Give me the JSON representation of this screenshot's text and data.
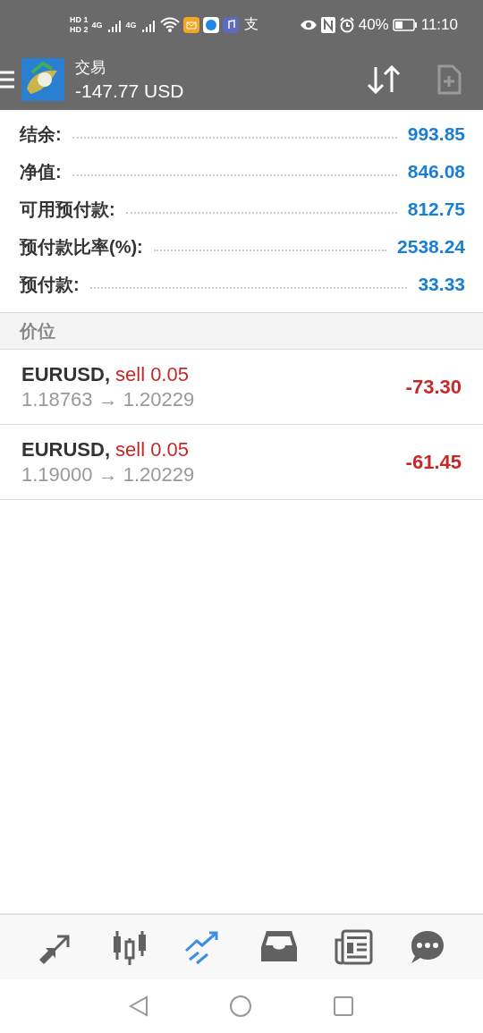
{
  "status_bar": {
    "sim": [
      {
        "hd": "HD",
        "slot": "1",
        "net": "4G"
      },
      {
        "hd": "HD",
        "slot": "2",
        "net": "4G"
      }
    ],
    "app_glyph": "支",
    "battery_text": "40%",
    "time": "11:10"
  },
  "app_bar": {
    "title": "交易",
    "subtitle": "-147.77 USD"
  },
  "summary": [
    {
      "label": "结余:",
      "value": "993.85"
    },
    {
      "label": "净值:",
      "value": "846.08"
    },
    {
      "label": "可用预付款:",
      "value": "812.75"
    },
    {
      "label": "预付款比率(%):",
      "value": "2538.24"
    },
    {
      "label": "预付款:",
      "value": "33.33"
    }
  ],
  "section": {
    "title": "价位"
  },
  "positions": [
    {
      "symbol": "EURUSD,",
      "order": "sell 0.05",
      "prices": "1.18763 → 1.20229",
      "profit": "-73.30"
    },
    {
      "symbol": "EURUSD,",
      "order": "sell 0.05",
      "prices": "1.19000 → 1.20229",
      "profit": "-61.45"
    }
  ],
  "bottom_nav": [
    {
      "kind": "quotes",
      "selected": false
    },
    {
      "kind": "chart",
      "selected": false
    },
    {
      "kind": "trade",
      "selected": true
    },
    {
      "kind": "history",
      "selected": false
    },
    {
      "kind": "news",
      "selected": false
    },
    {
      "kind": "chat",
      "selected": false
    }
  ]
}
